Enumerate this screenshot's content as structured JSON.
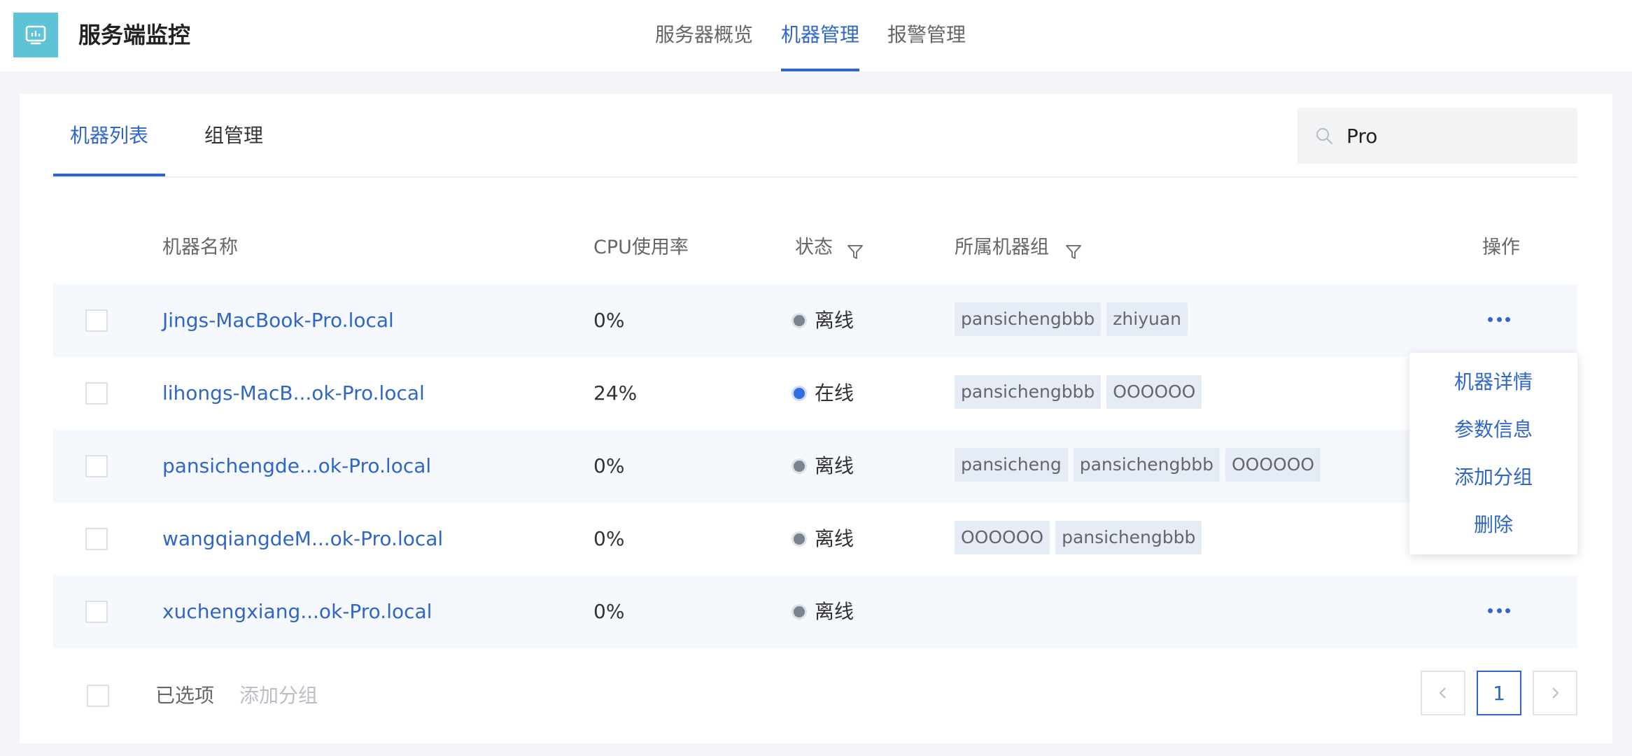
{
  "app": {
    "title": "服务端监控"
  },
  "topnav": {
    "items": [
      "服务器概览",
      "机器管理",
      "报警管理"
    ],
    "active": "机器管理"
  },
  "tabs": [
    "机器列表",
    "组管理"
  ],
  "search": {
    "value": "Pro"
  },
  "table": {
    "columns": [
      "机器名称",
      "CPU使用率",
      "状态",
      "所属机器组",
      "操作"
    ],
    "rows": [
      {
        "name": "Jings-MacBook-Pro.local",
        "cpu": "0%",
        "status": "离线",
        "groups": [
          "pansichengbbb",
          "zhiyuan"
        ]
      },
      {
        "name": "lihongs-MacB...ok-Pro.local",
        "cpu": "24%",
        "status": "在线",
        "groups": [
          "pansichengbbb",
          "OOOOOO"
        ]
      },
      {
        "name": "pansichengde...ok-Pro.local",
        "cpu": "0%",
        "status": "离线",
        "groups": [
          "pansicheng",
          "pansichengbbb",
          "OOOOOO"
        ]
      },
      {
        "name": "wangqiangdeM...ok-Pro.local",
        "cpu": "0%",
        "status": "离线",
        "groups": [
          "OOOOOO",
          "pansichengbbb"
        ]
      },
      {
        "name": "xuchengxiang...ok-Pro.local",
        "cpu": "0%",
        "status": "离线",
        "groups": []
      }
    ]
  },
  "action_menu": {
    "items": [
      "机器详情",
      "参数信息",
      "添加分组",
      "删除"
    ]
  },
  "footer": {
    "selected_label": "已选项",
    "add_group_label": "添加分组"
  },
  "pagination": {
    "current": "1"
  },
  "colors": {
    "accent": "#2f66c8",
    "logo_bg": "#5fc3d8",
    "online_dot": "#2f6fe0",
    "offline_dot": "#7b8290"
  },
  "icons": [
    "monitor-icon",
    "search-icon",
    "filter-icon",
    "more-icon",
    "chevron-left-icon",
    "chevron-right-icon"
  ]
}
